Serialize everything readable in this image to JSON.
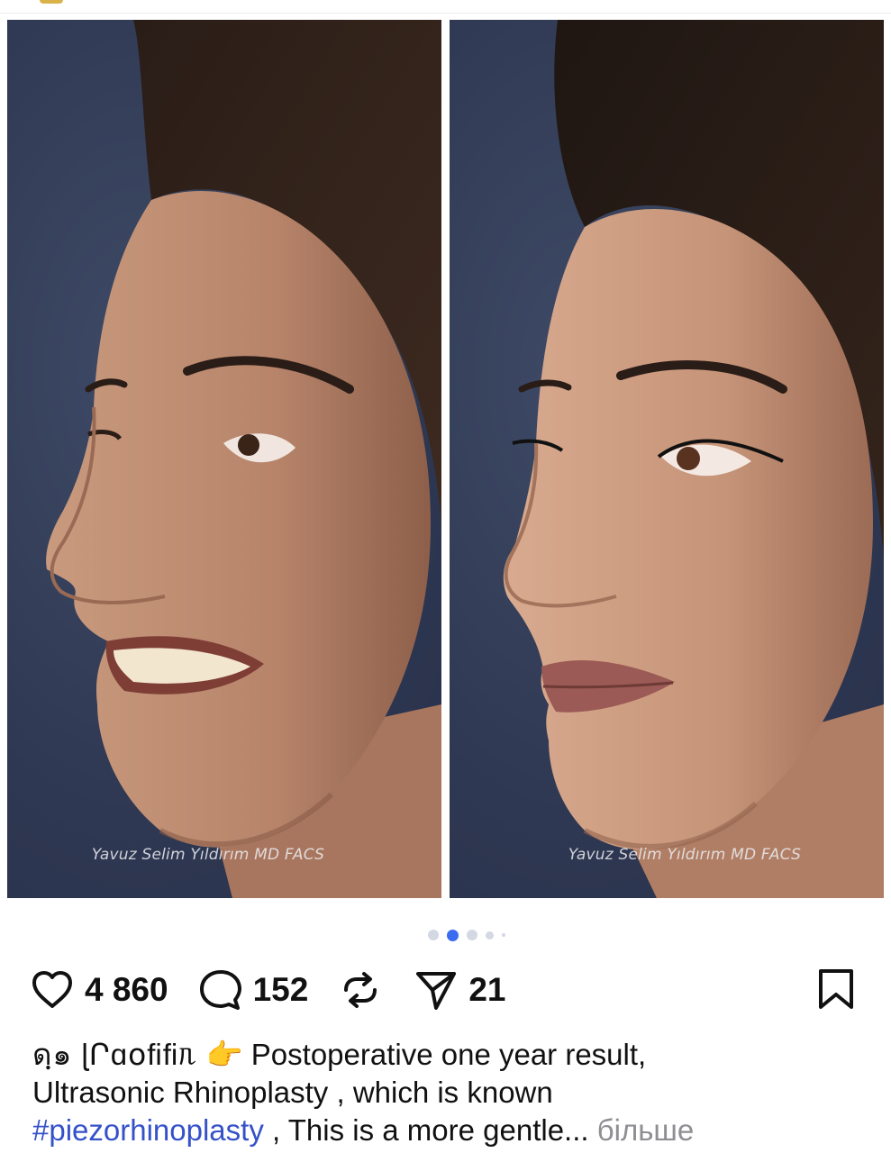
{
  "post": {
    "watermark_left": "Yavuz Selim Yıldırım MD FACS",
    "watermark_right": "Yavuz Selim Yıldırım MD FACS"
  },
  "carousel": {
    "total_dots": 5,
    "active_index": 1
  },
  "actions": {
    "likes": "4 860",
    "comments": "152",
    "shares": "21"
  },
  "caption": {
    "username": "ดฺ๑ ɭՐɑօﬁﬁᥰ",
    "pointer_emoji": "👉",
    "line1": "Postoperative one year result,",
    "line2": "Ultrasonic Rhinoplasty , which is known",
    "hashtag": "#piezorhinoplasty",
    "line3_rest": " , This is a more gentle...",
    "more_label": "більше"
  },
  "colors": {
    "accent": "#3b6cf0",
    "hashtag": "#3551c9",
    "muted": "#8e8e93",
    "photo_bg": "#2f3852"
  },
  "icons": {
    "like": "heart-icon",
    "comment": "comment-bubble-icon",
    "repost": "repost-icon",
    "share": "send-arrow-icon",
    "save": "bookmark-icon"
  }
}
